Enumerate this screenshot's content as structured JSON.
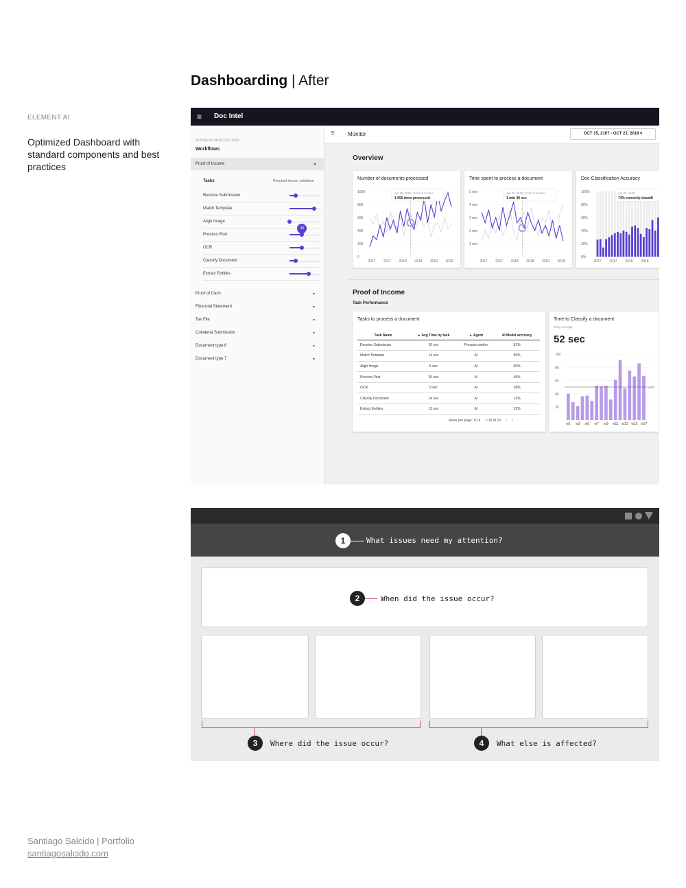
{
  "page": {
    "section_label": "ELEMENT AI",
    "section_desc": "Optimized Dashboard with standard components and best practices",
    "title_bold": "Dashboarding",
    "title_rest": " | After",
    "footer_name": "Santiago Salcido | Portfolio",
    "footer_link": "santiagosalcido.com"
  },
  "app": {
    "menu_icon": "≡",
    "title": "Doc Intel",
    "sidebar": {
      "kicker": "BUSINESS PROCESS KPIS",
      "workflows": "Workflows",
      "active_category": "Proof of Income",
      "tasks_header": "Tasks",
      "tasks_note": "Required human validation",
      "tasks": [
        {
          "label": "Receive Submission",
          "level": 0.2
        },
        {
          "label": "Match Template",
          "level": 0.78
        },
        {
          "label": "Align Image",
          "level": 0.0
        },
        {
          "label": "Process Post",
          "level": 0.4,
          "badge": "40"
        },
        {
          "label": "OCR",
          "level": 0.4
        },
        {
          "label": "Classify Document",
          "level": 0.2
        },
        {
          "label": "Extract Entities",
          "level": 0.6
        }
      ],
      "categories": [
        "Proof of Cash",
        "Financial Statement",
        "Tax File",
        "Collateral Submission",
        "Document type 6",
        "Document type 7"
      ]
    },
    "topbar": {
      "menu_icon": "≡",
      "label": "Monitor",
      "date_range": "OCT 15, 2107 - OCT 21, 2019 ▾"
    },
    "overview": {
      "heading": "Overview",
      "cards": [
        {
          "title": "Number of documents processed",
          "tooltip_date": "Apr 20, 2018 | Proof of income",
          "tooltip_value": "1 050 docs processed",
          "yticks": [
            "1000",
            "800",
            "600",
            "400",
            "200",
            "0"
          ],
          "xticks": [
            "2017",
            "2017",
            "2018",
            "2018",
            "2019",
            "2019"
          ]
        },
        {
          "title": "Time spent to process a document",
          "tooltip_date": "Apr 20, 2018 | Proof of income",
          "tooltip_value": "1 min 40 sec",
          "yticks": [
            "5 min",
            "4 min",
            "3 min",
            "2 min",
            "1 min",
            ""
          ],
          "xticks": [
            "2017",
            "2017",
            "2018",
            "2018",
            "2019",
            "2019"
          ]
        },
        {
          "title": "Doc Classification Accuracy",
          "tooltip_date": "Apr 20, 2018",
          "tooltip_value": "74% correctly classifi",
          "yticks": [
            "100%",
            "80%",
            "60%",
            "40%",
            "20%",
            "0%"
          ],
          "xticks": [
            "2017",
            "2017",
            "2018",
            "2018",
            "20"
          ]
        }
      ]
    },
    "proof_of_income": {
      "heading": "Proof of Income",
      "subheading": "Task Performance",
      "table": {
        "title": "Tasks to process a document",
        "headers": [
          "Task Name",
          "▲ Avg Time by task",
          "▲ Agent",
          "AI Model accuracy"
        ],
        "rows": [
          [
            "Receive Submission",
            "10 sec",
            "Process worker",
            "81%"
          ],
          [
            "Match Template",
            "14 sec",
            "AI",
            "86%"
          ],
          [
            "Align Image",
            "5 sec",
            "AI",
            "50%"
          ],
          [
            "Process Post",
            "20 sec",
            "AI",
            "49%"
          ],
          [
            "OCR",
            "9 sec",
            "AI",
            "28%"
          ],
          [
            "Classify Document",
            "14 sec",
            "AI",
            "13%"
          ],
          [
            "Extract Entities",
            "13 sec",
            "AI",
            "32%"
          ]
        ],
        "rows_per_page": "Rows per page: 10 ▾",
        "range": "1-10 of 20",
        "prev": "‹",
        "next": "›"
      },
      "classify": {
        "title": "Time to Classify a document",
        "subtitle": "Daily Average",
        "value": "52 sec",
        "avg_label": "AVG"
      }
    }
  },
  "chart_data": [
    {
      "type": "line",
      "title": "Number of documents processed",
      "ylim": [
        0,
        1000
      ],
      "x": [
        "2017",
        "2017",
        "2018",
        "2018",
        "2019",
        "2019"
      ],
      "series": [
        {
          "values": [
            150,
            320,
            260,
            480,
            300,
            600,
            420,
            560,
            360,
            700,
            460,
            740,
            520,
            420,
            680,
            560,
            900,
            520,
            800,
            600,
            950,
            700,
            860,
            980,
            760
          ]
        },
        {
          "values": [
            600,
            500,
            650,
            420,
            550,
            380,
            700,
            500,
            430,
            610,
            320,
            540,
            680,
            400,
            500,
            620,
            450,
            560,
            300,
            480,
            520,
            380,
            600,
            420,
            500
          ]
        }
      ]
    },
    {
      "type": "line",
      "title": "Time spent to process a document",
      "x": [
        "2017",
        "2017",
        "2018",
        "2018",
        "2019",
        "2019"
      ],
      "series": [
        {
          "values": [
            3.4,
            2.6,
            3.6,
            2.2,
            3.0,
            2.0,
            3.8,
            2.4,
            3.2,
            4.2,
            2.6,
            3.0,
            2.2,
            3.4,
            2.6,
            2.0,
            2.8,
            1.8,
            2.4,
            1.6,
            2.8,
            1.4,
            2.4,
            1.2
          ]
        },
        {
          "values": [
            1.2,
            2.0,
            1.4,
            2.6,
            1.8,
            3.2,
            1.6,
            2.2,
            3.6,
            2.0,
            1.2,
            2.8,
            3.4,
            2.2,
            3.8,
            2.4,
            1.6,
            3.0,
            2.6,
            3.6,
            2.0,
            1.4,
            3.2,
            4.0
          ]
        }
      ]
    },
    {
      "type": "bar",
      "title": "Doc Classification Accuracy",
      "ylim": [
        0,
        100
      ],
      "values": [
        26,
        27,
        14,
        27,
        30,
        33,
        36,
        38,
        36,
        40,
        38,
        34,
        46,
        48,
        44,
        35,
        30,
        44,
        42,
        56,
        40,
        60,
        73,
        67
      ]
    },
    {
      "type": "bar",
      "title": "Time to Classify a document",
      "ylim": [
        0,
        100
      ],
      "categories": [
        "w1",
        "w2",
        "w3",
        "w4",
        "w5",
        "w6",
        "w7",
        "w8",
        "w9",
        "w10",
        "w11",
        "w12",
        "w13",
        "w14",
        "w15",
        "w16",
        "w17"
      ],
      "x_tick_labels": [
        "w1",
        "w3",
        "w5",
        "w7",
        "w9",
        "w11",
        "w13",
        "w15",
        "w17"
      ],
      "yticks": [
        "100",
        "80",
        "60",
        "40",
        "20"
      ],
      "values": [
        40,
        27,
        21,
        36,
        37,
        29,
        52,
        51,
        52,
        31,
        61,
        91,
        48,
        75,
        66,
        86,
        67
      ],
      "average": 50
    }
  ],
  "framework": {
    "q1": {
      "num": "1",
      "text": "What issues need my attention?"
    },
    "q2": {
      "num": "2",
      "text": "When did the issue occur?"
    },
    "q3": {
      "num": "3",
      "text": "Where did the issue occur?"
    },
    "q4": {
      "num": "4",
      "text": "What else is affected?"
    },
    "accent": "#e04868"
  }
}
